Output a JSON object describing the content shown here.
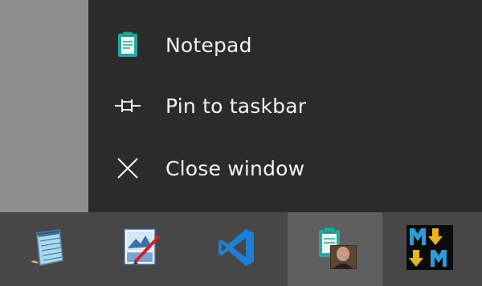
{
  "jumplist": {
    "items": [
      {
        "label": "Notepad",
        "icon": "notepad-icon"
      },
      {
        "label": "Pin to taskbar",
        "icon": "pin-icon"
      },
      {
        "label": "Close window",
        "icon": "close-icon"
      }
    ]
  },
  "taskbar": {
    "buttons": [
      {
        "icon": "notepad-app-icon"
      },
      {
        "icon": "paint-app-icon"
      },
      {
        "icon": "vscode-app-icon"
      },
      {
        "icon": "clipboard-photo-app-icon",
        "active": true
      },
      {
        "icon": "markdown-monster-app-icon"
      }
    ]
  },
  "colors": {
    "desktop": "#8d8d8d",
    "jumplist_bg": "#2b2b2b",
    "taskbar_bg": "#474747",
    "active_button_bg": "#5f5f5f",
    "accent_teal": "#2aa79b",
    "vscode_blue": "#1e7fd6"
  }
}
